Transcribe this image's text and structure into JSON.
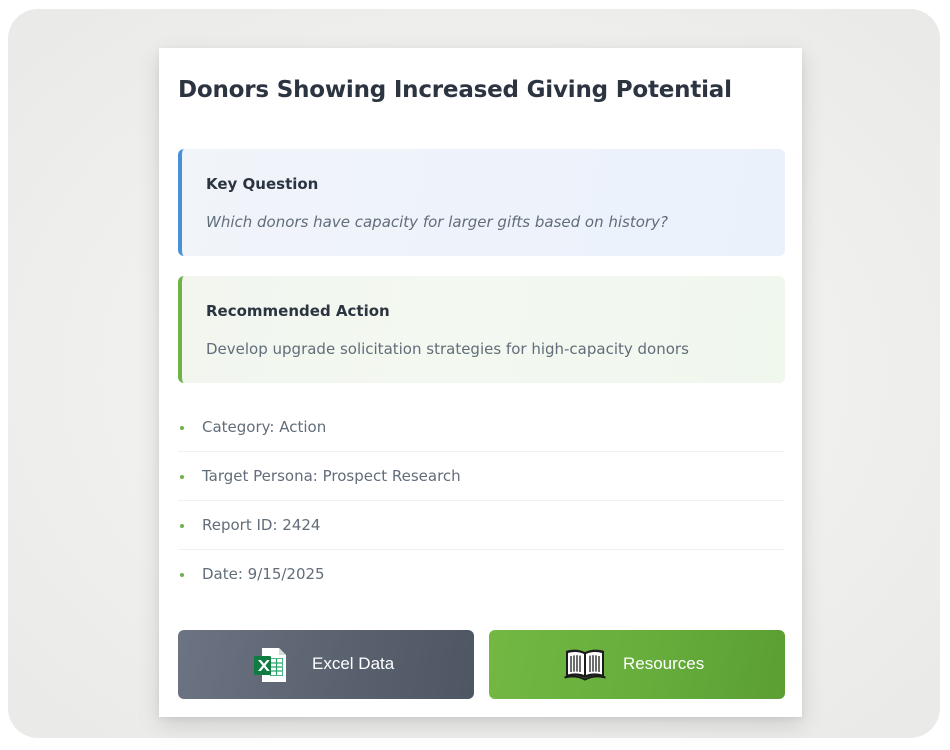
{
  "card": {
    "title": "Donors Showing Increased Giving Potential",
    "key_question": {
      "label": "Key Question",
      "text": "Which donors have capacity for larger gifts based on history?"
    },
    "recommended_action": {
      "label": "Recommended Action",
      "text": "Develop upgrade solicitation strategies for high-capacity donors"
    },
    "details": [
      "Category: Action",
      "Target Persona: Prospect Research",
      "Report ID: 2424",
      "Date: 9/15/2025"
    ],
    "buttons": {
      "excel": {
        "label": "Excel Data",
        "icon": "excel-file-icon"
      },
      "resources": {
        "label": "Resources",
        "icon": "open-book-icon"
      }
    }
  },
  "colors": {
    "question_accent": "#4a90d9",
    "action_accent": "#6db34a",
    "excel_button": "#5a6270",
    "resources_button": "#66ad3c",
    "title_text": "#2b3440",
    "body_text": "#626d7a"
  }
}
